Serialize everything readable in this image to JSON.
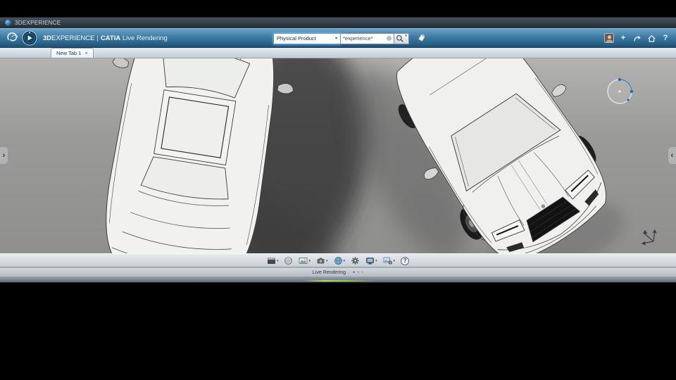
{
  "window": {
    "title": "3DEXPERIENCE"
  },
  "header": {
    "brand": {
      "bold": "3D",
      "regular": "EXPERIENCE",
      "divider": "|",
      "app": "CATIA",
      "module": "Live Rendering"
    },
    "search": {
      "scope": "Physical Product",
      "caret": "▾",
      "query": "*experience*"
    },
    "actions": {
      "add": "+",
      "help": "?"
    }
  },
  "tabbar": {
    "tabs": [
      {
        "label": "New Tab 1",
        "close": "×"
      }
    ]
  },
  "viewport": {
    "left_chevron": "‹",
    "right_chevron": "›"
  },
  "toolbar": {
    "caret": "▾",
    "help_glyph": "?",
    "icons": [
      {
        "name": "render-media"
      },
      {
        "name": "material-sphere"
      },
      {
        "name": "image-capture"
      },
      {
        "name": "camera"
      },
      {
        "name": "environment-globe"
      },
      {
        "name": "render-settings-gear"
      },
      {
        "name": "display-output"
      },
      {
        "name": "batch-render-settings"
      },
      {
        "name": "help"
      }
    ]
  },
  "statusbar": {
    "label": "Live Rendering",
    "dot": "●"
  },
  "colors": {
    "header_blue": "#3d7ba4",
    "accent_blue": "#1f6bb5",
    "viewport_gray": "#9a9a99"
  }
}
